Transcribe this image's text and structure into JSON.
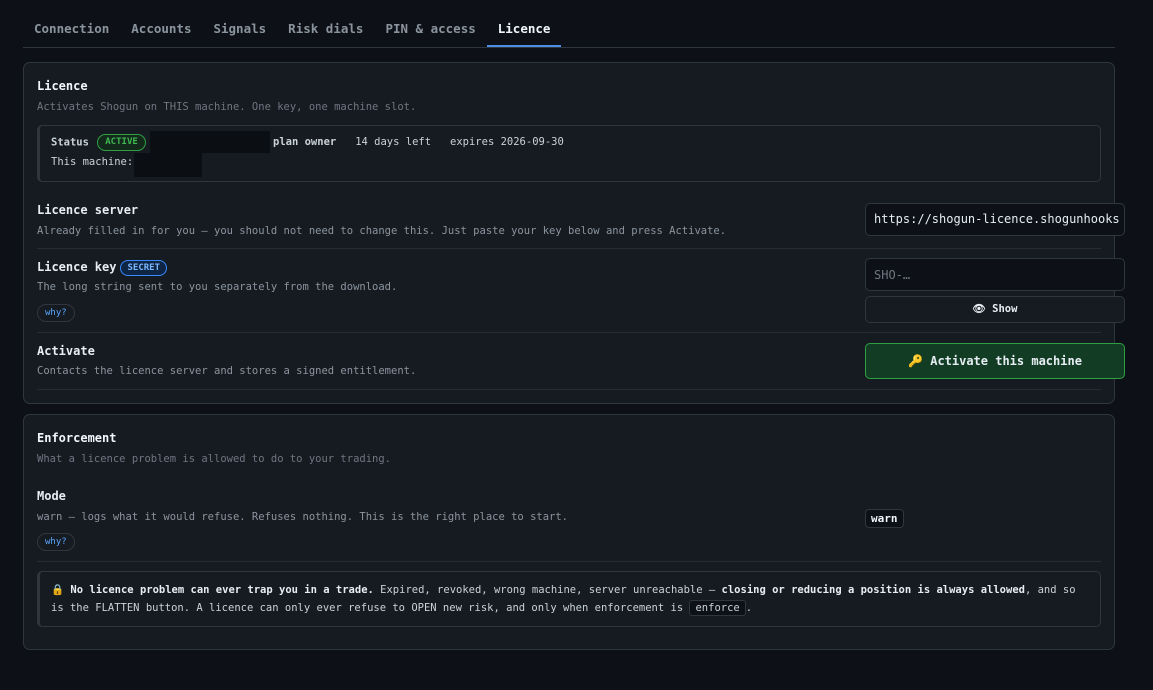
{
  "tabs": [
    {
      "label": "Connection"
    },
    {
      "label": "Accounts"
    },
    {
      "label": "Signals"
    },
    {
      "label": "Risk dials"
    },
    {
      "label": "PIN & access"
    },
    {
      "label": "Licence"
    }
  ],
  "licence": {
    "title": "Licence",
    "subtitle": "Activates Shogun on THIS machine. One key, one machine slot.",
    "status": {
      "label": "Status",
      "badge": "ACTIVE",
      "plan": "plan owner",
      "days_left": "14 days left",
      "expires": "expires 2026-09-30",
      "machine_label": "This machine:"
    },
    "server": {
      "title": "Licence server",
      "desc": "Already filled in for you — you should not need to change this. Just paste your key below and press Activate.",
      "value": "https://shogun-licence.shogunhooks"
    },
    "key": {
      "title": "Licence key",
      "badge": "SECRET",
      "desc": "The long string sent to you separately from the download.",
      "why": "why?",
      "placeholder": "SHO-…",
      "show_label": "👁 Show"
    },
    "activate": {
      "title": "Activate",
      "desc": "Contacts the licence server and stores a signed entitlement.",
      "button": "🔑 Activate this machine"
    }
  },
  "enforcement": {
    "title": "Enforcement",
    "subtitle": "What a licence problem is allowed to do to your trading.",
    "mode": {
      "title": "Mode",
      "desc": "warn — logs what it would refuse. Refuses nothing. This is the right place to start.",
      "why": "why?",
      "value": "warn"
    },
    "note": {
      "icon": "🔒",
      "bold1": "No licence problem can ever trap you in a trade.",
      "text1": " Expired, revoked, wrong machine, server unreachable — ",
      "bold2": "closing or reducing a position is always allowed",
      "text2": ", and so is the FLATTEN button. A licence can only ever refuse to OPEN new risk, and only when enforcement is ",
      "code": "enforce",
      "text3": "."
    }
  },
  "colors": {
    "background": "#0d1117",
    "card": "#161b22",
    "accent": "#4c8ee6",
    "success": "#2ea043",
    "link": "#58a6ff"
  }
}
